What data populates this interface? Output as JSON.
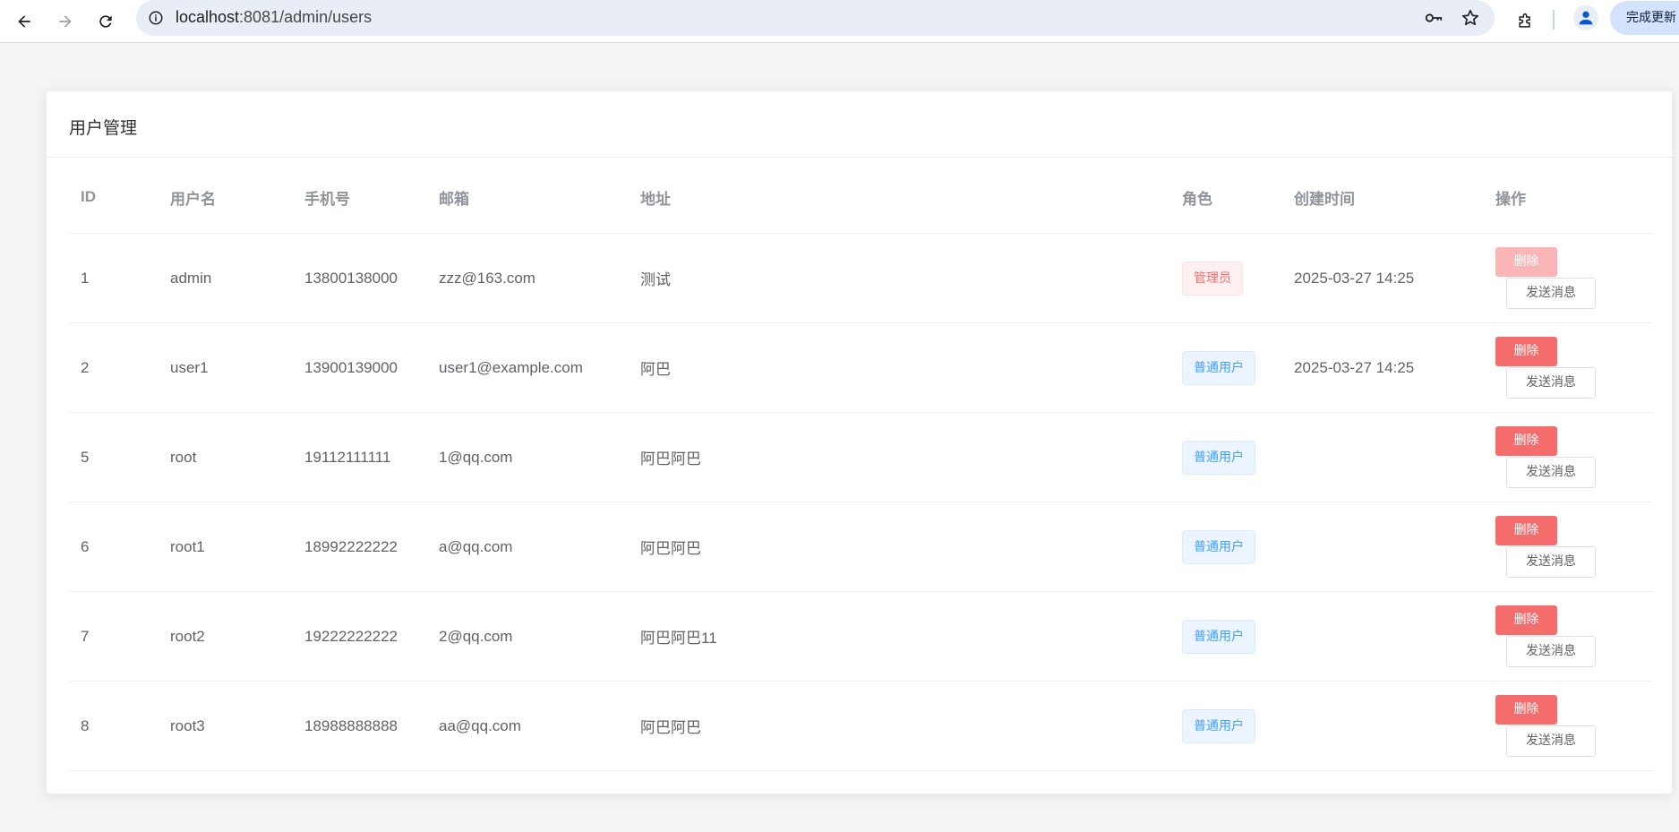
{
  "browser": {
    "url_host": "localhost",
    "url_rest": ":8081/admin/users",
    "update_label": "完成更新"
  },
  "page": {
    "title": "用户管理",
    "columns": {
      "id": "ID",
      "username": "用户名",
      "phone": "手机号",
      "email": "邮箱",
      "address": "地址",
      "role": "角色",
      "created": "创建时间",
      "actions": "操作"
    },
    "rows": [
      {
        "id": "1",
        "username": "admin",
        "phone": "13800138000",
        "email": "zzz@163.com",
        "address": "测试",
        "role": "管理员",
        "created": "2025-03-27 14:25",
        "delete": "删除",
        "message": "发送消息"
      },
      {
        "id": "2",
        "username": "user1",
        "phone": "13900139000",
        "email": "user1@example.com",
        "address": "阿巴",
        "role": "普通用户",
        "created": "2025-03-27 14:25",
        "delete": "删除",
        "message": "发送消息"
      },
      {
        "id": "5",
        "username": "root",
        "phone": "19112111111",
        "email": "1@qq.com",
        "address": "阿巴阿巴",
        "role": "普通用户",
        "created": "",
        "delete": "删除",
        "message": "发送消息"
      },
      {
        "id": "6",
        "username": "root1",
        "phone": "18992222222",
        "email": "a@qq.com",
        "address": "阿巴阿巴",
        "role": "普通用户",
        "created": "",
        "delete": "删除",
        "message": "发送消息"
      },
      {
        "id": "7",
        "username": "root2",
        "phone": "19222222222",
        "email": "2@qq.com",
        "address": "阿巴阿巴11",
        "role": "普通用户",
        "created": "",
        "delete": "删除",
        "message": "发送消息"
      },
      {
        "id": "8",
        "username": "root3",
        "phone": "18988888888",
        "email": "aa@qq.com",
        "address": "阿巴阿巴",
        "role": "普通用户",
        "created": "",
        "delete": "删除",
        "message": "发送消息"
      }
    ]
  },
  "colors": {
    "danger": "#f56c6c",
    "primary": "#409eff"
  }
}
